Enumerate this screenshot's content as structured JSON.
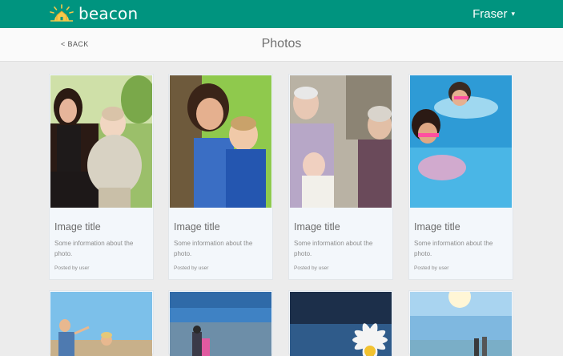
{
  "header": {
    "app_name": "beacon",
    "user_name": "Fraser",
    "user_caret": "▾",
    "brand_color": "#00947f"
  },
  "subheader": {
    "back_label": "< BACK",
    "title": "Photos"
  },
  "cards": [
    {
      "title": "Image title",
      "description": "Some information about the photo.",
      "meta": "Posted by user"
    },
    {
      "title": "Image title",
      "description": "Some information about the photo.",
      "meta": "Posted by user"
    },
    {
      "title": "Image title",
      "description": "Some information about the photo.",
      "meta": "Posted by user"
    },
    {
      "title": "Image title",
      "description": "Some information about the photo.",
      "meta": "Posted by user"
    }
  ]
}
